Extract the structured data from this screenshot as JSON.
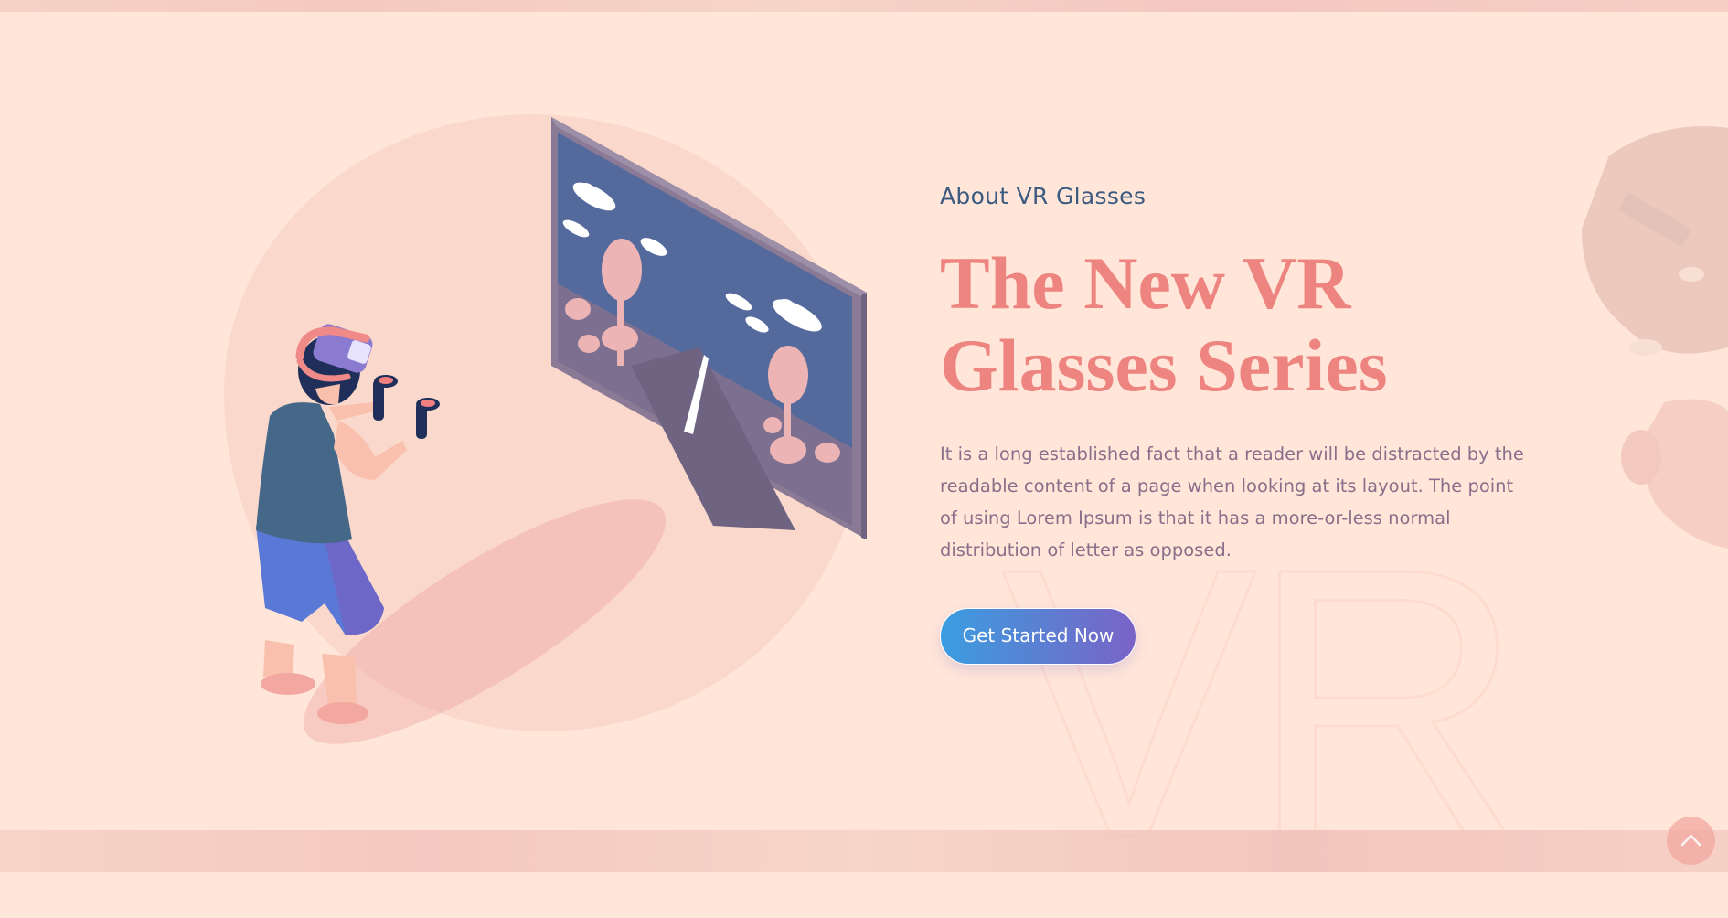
{
  "hero": {
    "eyebrow": "About VR Glasses",
    "headline": "The New VR Glasses Series",
    "description": "It is a long established fact that a reader will be distracted by the readable content of a page when looking at its layout. The point of using Lorem Ipsum is that it has a more-or-less normal distribution of letter as opposed.",
    "cta_label": "Get Started Now",
    "watermark": "VR"
  },
  "icons": {
    "scroll_top": "chevron-up-icon"
  },
  "colors": {
    "background": "#ffe6d9",
    "headline": "#ee8480",
    "eyebrow": "#3c5a80",
    "body_text": "#8a6f8a",
    "cta_gradient_start": "#3b9de0",
    "cta_gradient_end": "#7a63c6"
  }
}
